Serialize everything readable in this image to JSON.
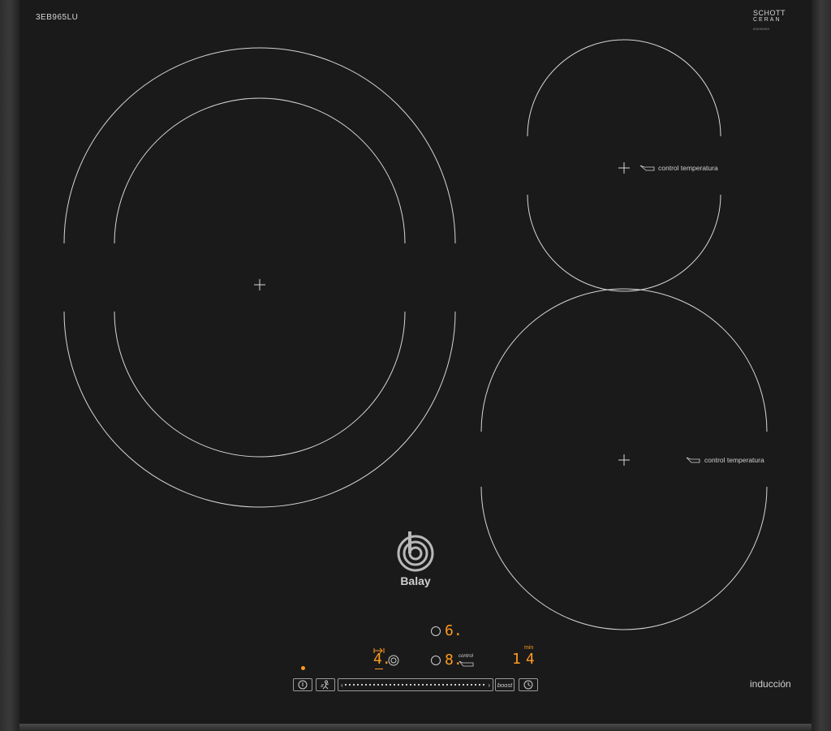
{
  "panel": {
    "model_code": "3EB965LU",
    "glass_brand_line1": "SCHOTT",
    "glass_brand_line2": "CERAN",
    "glass_brand_code": "00000000",
    "footer_label": "inducción",
    "brand_name": "Balay"
  },
  "zones": {
    "top_right_label": "control temperatura",
    "bottom_right_label": "control temperatura"
  },
  "display": {
    "zone_top_level": "6.",
    "zone_left_level": "4.",
    "zone_center_level": "8.",
    "zone_center_tag": "control",
    "timer_unit": "min",
    "timer_value": "14"
  },
  "controls": {
    "boost_label": "boost"
  },
  "colors": {
    "display_orange": "#ff9a1f",
    "glass": "#1a1a1a",
    "print": "#cfcfcf"
  }
}
